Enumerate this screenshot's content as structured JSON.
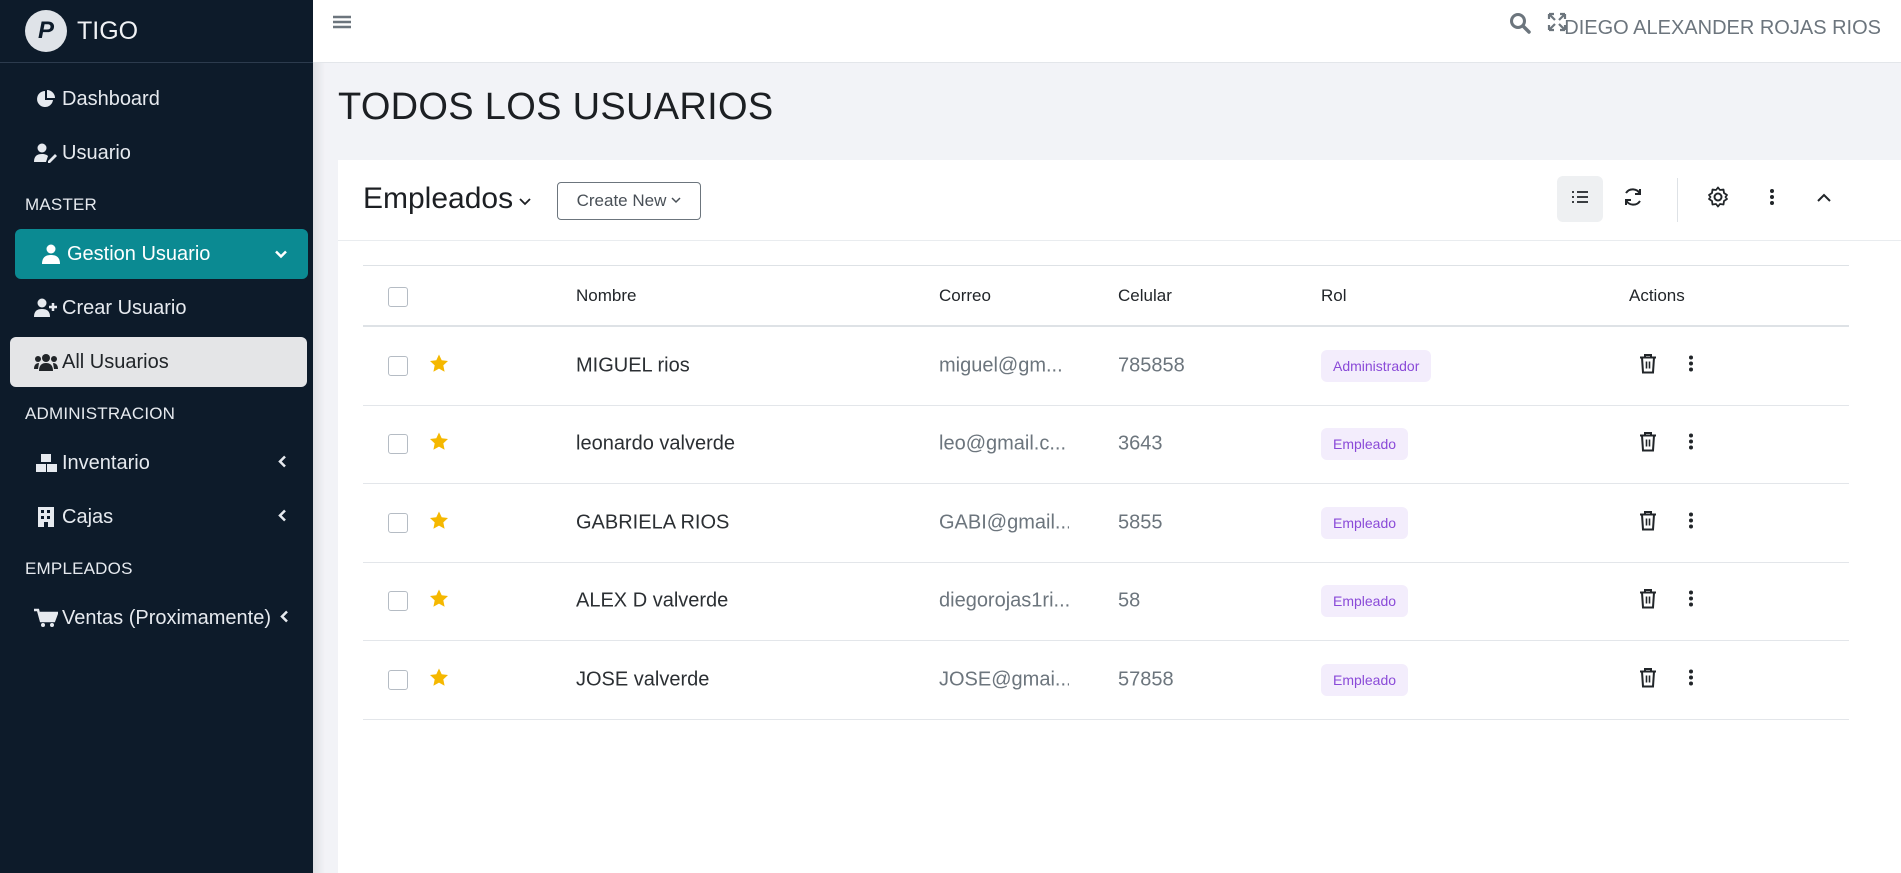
{
  "brand": {
    "logo_letter": "P",
    "title": "TIGO"
  },
  "sidebar": {
    "items": [
      {
        "label": "Dashboard",
        "icon": "chart-pie-icon"
      },
      {
        "label": "Usuario",
        "icon": "user-edit-icon"
      }
    ],
    "header_master": "MASTER",
    "gestion": {
      "label": "Gestion Usuario",
      "icon": "user-icon",
      "active_color": "#0b8a92"
    },
    "crear": {
      "label": "Crear Usuario",
      "icon": "user-plus-icon"
    },
    "all": {
      "label": "All Usuarios",
      "icon": "users-icon"
    },
    "header_admin": "ADMINISTRACION",
    "inventario": {
      "label": "Inventario",
      "icon": "cubes-icon"
    },
    "cajas": {
      "label": "Cajas",
      "icon": "cash-register-icon"
    },
    "header_empleados": "EMPLEADOS",
    "ventas": {
      "label": "Ventas (Proximamente)",
      "icon": "cart-icon"
    }
  },
  "topbar": {
    "user_name": "DIEGO ALEXANDER ROJAS RIOS"
  },
  "page": {
    "title": "TODOS LOS USUARIOS"
  },
  "card": {
    "title": "Empleados",
    "create_label": "Create New",
    "columns": {
      "nombre": "Nombre",
      "correo": "Correo",
      "celular": "Celular",
      "rol": "Rol",
      "actions": "Actions"
    },
    "rows": [
      {
        "nombre": "MIGUEL rios",
        "correo": "miguel@gm...",
        "celular": "785858",
        "rol": "Administrador"
      },
      {
        "nombre": "leonardo valverde",
        "correo": "leo@gmail.c...",
        "celular": "3643",
        "rol": "Empleado"
      },
      {
        "nombre": "GABRIELA RIOS",
        "correo": "GABI@gmail...",
        "celular": "5855",
        "rol": "Empleado"
      },
      {
        "nombre": "ALEX D valverde",
        "correo": "diegorojas1ri...",
        "celular": "58",
        "rol": "Empleado"
      },
      {
        "nombre": "JOSE valverde",
        "correo": "JOSE@gmai...",
        "celular": "57858",
        "rol": "Empleado"
      }
    ]
  },
  "colors": {
    "sidebar_bg": "#0d1b2a",
    "accent": "#0b8a92",
    "star": "#f5b800",
    "badge_text": "#8a4ad8",
    "badge_bg": "#f3edfc"
  }
}
